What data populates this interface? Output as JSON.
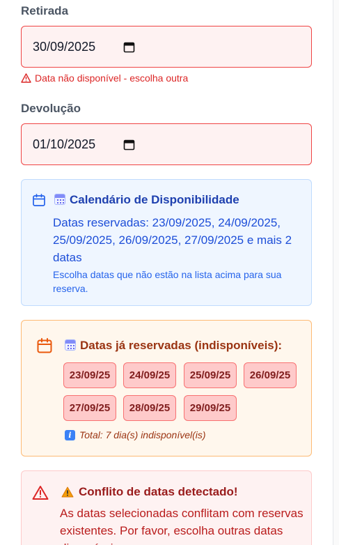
{
  "pickup": {
    "label": "Retirada",
    "value": "30/09/2025",
    "error": "Data não disponível - escolha outra"
  },
  "return": {
    "label": "Devolução",
    "value": "01/10/2025"
  },
  "availability": {
    "emoji": "🗓️",
    "title": "Calendário de Disponibilidade",
    "reserved_text": "Datas reservadas: 23/09/2025, 24/09/2025, 25/09/2025, 26/09/2025, 27/09/2025 e mais 2 datas",
    "hint": "Escolha datas que não estão na lista acima para sua reserva."
  },
  "booked": {
    "title": "Datas já reservadas (indisponíveis):",
    "dates": [
      "23/09/25",
      "24/09/25",
      "25/09/25",
      "26/09/25",
      "27/09/25",
      "28/09/25",
      "29/09/25"
    ],
    "info_icon": "ℹ️",
    "total": "Total: 7 dia(s) indisponível(is)"
  },
  "conflict": {
    "warn_emoji": "⚠️",
    "title": "Conflito de datas detectado!",
    "message": "As datas selecionadas conflitam com reservas existentes. Por favor, escolha outras datas disponíveis."
  },
  "colors": {
    "error": "#dc2626",
    "blue_title": "#1e40af",
    "blue_text": "#1d4ed8",
    "orange_title": "#9a3412",
    "orange_icon": "#ea580c",
    "red_title": "#991b1b"
  },
  "icons": [
    "alert-triangle-icon",
    "calendar-icon",
    "info-icon",
    "warning-emoji-icon"
  ]
}
